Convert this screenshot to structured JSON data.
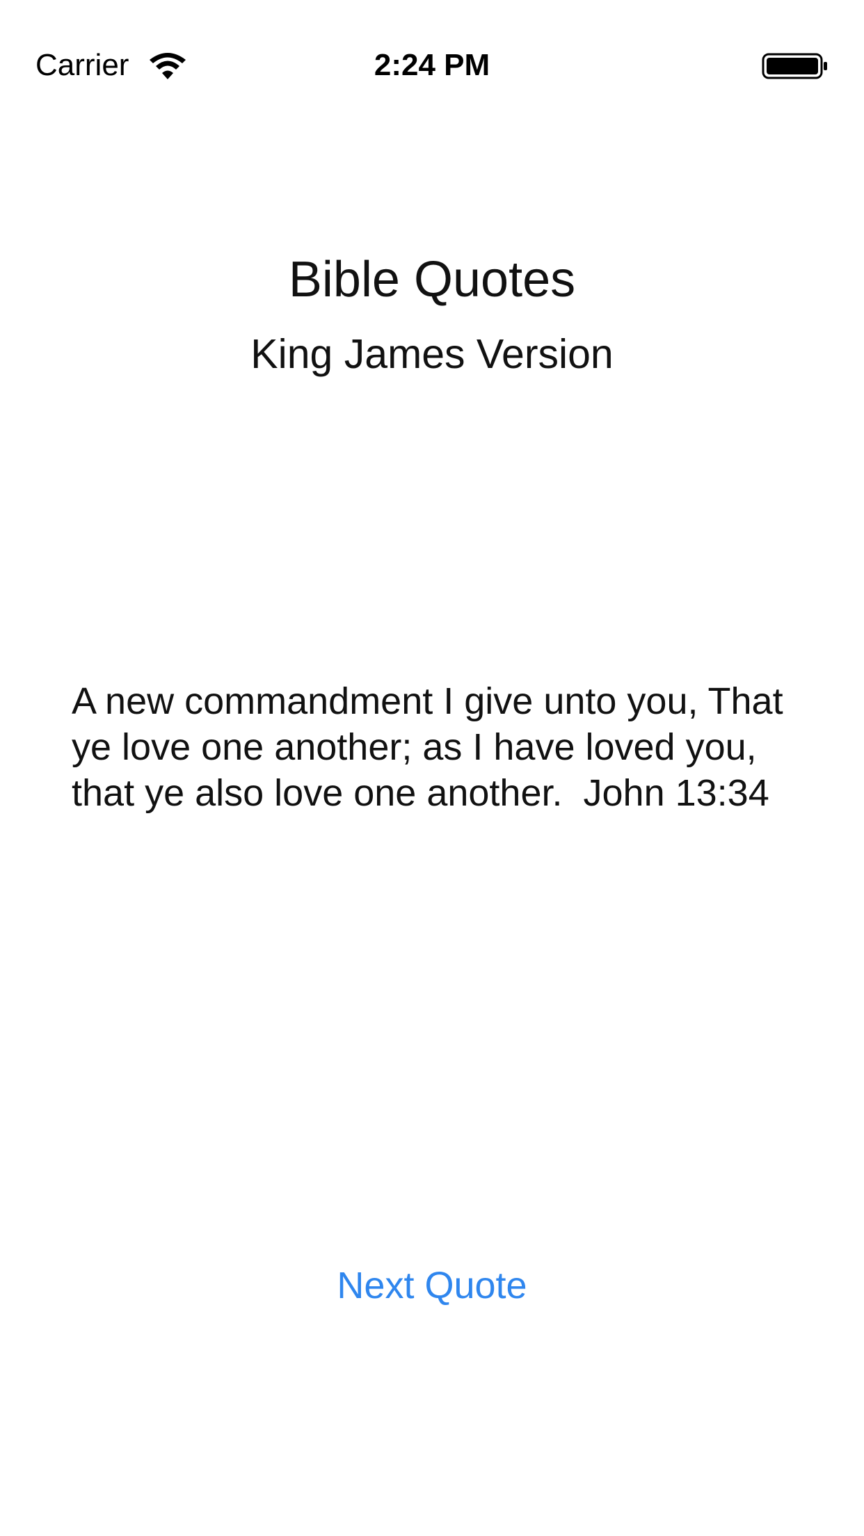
{
  "status_bar": {
    "carrier": "Carrier",
    "time": "2:24 PM",
    "wifi_icon": "wifi-icon",
    "battery_icon": "battery-full-icon"
  },
  "header": {
    "title": "Bible Quotes",
    "subtitle": "King James Version"
  },
  "quote": {
    "text": "A new commandment I give unto you, That ye love one another; as I have loved you, that ye also love one another.  John 13:34"
  },
  "actions": {
    "next_label": "Next Quote"
  },
  "colors": {
    "accent": "#2f86ee",
    "text": "#111111",
    "background": "#ffffff"
  }
}
